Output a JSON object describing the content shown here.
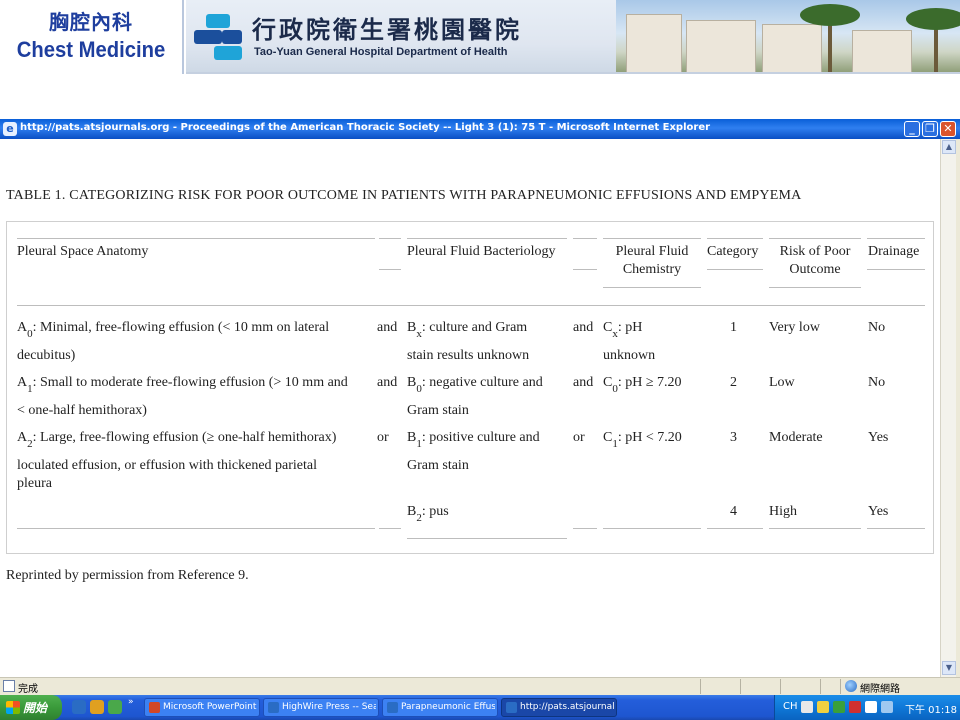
{
  "banner": {
    "dept_zh": "胸腔內科",
    "dept_en": "Chest Medicine",
    "hospital_zh": "行政院衛生署桃園醫院",
    "hospital_en": "Tao-Yuan General Hospital Department of Health"
  },
  "window": {
    "title": "http://pats.atsjournals.org - Proceedings of the American Thoracic Society -- Light 3 (1): 75 T - Microsoft Internet Explorer",
    "minimize": "_",
    "restore": "❐",
    "close": "✕"
  },
  "article": {
    "table_title": "TABLE 1. CATEGORIZING RISK FOR POOR OUTCOME IN PATIENTS WITH PARAPNEUMONIC EFFUSIONS AND EMPYEMA",
    "headers": {
      "anatomy": "Pleural Space Anatomy",
      "bacteriology": "Pleural Fluid Bacteriology",
      "chemistry": "Pleural Fluid Chemistry",
      "category": "Category",
      "risk": "Risk of Poor Outcome",
      "drainage": "Drainage"
    },
    "rows": [
      {
        "a_sym": "A",
        "a_sub": "0",
        "a_text": ": Minimal, free-flowing effusion (< 10 mm on lateral",
        "a_text2": "decubitus)",
        "conj1": "and",
        "b_sym": "B",
        "b_sub": "x",
        "b_text": ": culture and Gram",
        "b_text2": "stain results unknown",
        "conj2": "and",
        "c_sym": "C",
        "c_sub": "x",
        "c_text": ": pH",
        "c_text2": "unknown",
        "category": "1",
        "risk": "Very low",
        "drainage": "No"
      },
      {
        "a_sym": "A",
        "a_sub": "1",
        "a_text": ": Small to moderate free-flowing effusion (> 10 mm and",
        "a_text2": "< one-half hemithorax)",
        "conj1": "and",
        "b_sym": "B",
        "b_sub": "0",
        "b_text": ": negative culture and",
        "b_text2": "Gram stain",
        "conj2": "and",
        "c_sym": "C",
        "c_sub": "0",
        "c_text": ": pH ≥ 7.20",
        "c_text2": "",
        "category": "2",
        "risk": "Low",
        "drainage": "No"
      },
      {
        "a_sym": "A",
        "a_sub": "2",
        "a_text": ": Large, free-flowing effusion (≥ one-half hemithorax)",
        "a_text2": "loculated effusion, or effusion with thickened parietal",
        "a_text3": "pleura",
        "conj1": "or",
        "b_sym": "B",
        "b_sub": "1",
        "b_text": ": positive culture and",
        "b_text2": "Gram stain",
        "conj2": "or",
        "c_sym": "C",
        "c_sub": "1",
        "c_text": ": pH < 7.20",
        "c_text2": "",
        "category": "3",
        "risk": "Moderate",
        "drainage": "Yes"
      },
      {
        "b_sym": "B",
        "b_sub": "2",
        "b_text": ": pus",
        "category": "4",
        "risk": "High",
        "drainage": "Yes"
      }
    ],
    "reprint": "Reprinted by permission from Reference 9."
  },
  "statusbar": {
    "status": "完成",
    "zone": "網際網路"
  },
  "taskbar": {
    "start": "開始",
    "chevron": "»",
    "tasks": [
      {
        "label": "Microsoft PowerPoint ...",
        "icon_color": "#d24726"
      },
      {
        "label": "HighWire Press -- Sear...",
        "icon_color": "#2a6cc4"
      },
      {
        "label": "Parapneumonic Effusi...",
        "icon_color": "#2a6cc4"
      },
      {
        "label": "http://pats.atsjournals.o...",
        "icon_color": "#2a6cc4"
      }
    ],
    "lang": "CH",
    "clock": "下午 01:18"
  },
  "colors": {
    "titlebar": "#0a5fd8",
    "taskbar": "#245edb",
    "start": "#3a9a3a",
    "dept_text": "#1e3e9e"
  }
}
